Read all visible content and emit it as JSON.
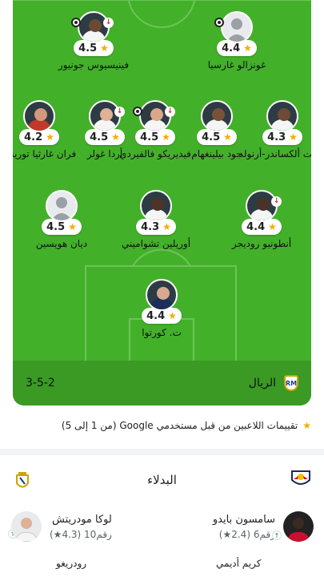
{
  "pitch": {
    "colors": {
      "grass": "#43b02a",
      "bar": "#3a9a24",
      "line": "#6cc456"
    },
    "team": {
      "name": "الريال",
      "formation": "3-5-2",
      "crest_text": "RM"
    },
    "players": [
      {
        "id": "vinicius",
        "name": "فينيسيوس جونيور",
        "rating": "4.5",
        "sub": true,
        "ball": true,
        "skin": "#6b4a34",
        "shirt": "#f5f5f5"
      },
      {
        "id": "garcia",
        "name": "غونزالو غارسيا",
        "rating": "4.4",
        "sub": false,
        "ball": true,
        "placeholder": true
      },
      {
        "id": "arnold",
        "name": "ترينت ألكساندر-أرنولد",
        "rating": "4.3",
        "sub": false,
        "ball": false,
        "skin": "#6e4b36",
        "shirt": "#f5f5f5"
      },
      {
        "id": "bellingham",
        "name": "جود بيلينغهام",
        "rating": "4.5",
        "sub": false,
        "ball": false,
        "skin": "#7a5238",
        "shirt": "#f5f5f5"
      },
      {
        "id": "valverde",
        "name": "فيديريكو فالفيردي",
        "rating": "4.5",
        "sub": true,
        "ball": true,
        "skin": "#d9a88a",
        "shirt": "#f5f5f5"
      },
      {
        "id": "guler",
        "name": "أردا غولر",
        "rating": "4.5",
        "sub": true,
        "ball": false,
        "skin": "#e0b195",
        "shirt": "#f5f5f5"
      },
      {
        "id": "torres",
        "name": "فران غارثيا توريس",
        "rating": "4.2",
        "sub": false,
        "ball": false,
        "skin": "#d29a7c",
        "shirt": "#c0392b"
      },
      {
        "id": "rudiger",
        "name": "أنطونيو روديجر",
        "rating": "4.4",
        "sub": true,
        "ball": false,
        "skin": "#4a3326",
        "shirt": "#f5f5f5"
      },
      {
        "id": "tchouameni",
        "name": "أوريلين تشواميني",
        "rating": "4.3",
        "sub": false,
        "ball": false,
        "skin": "#4e3427",
        "shirt": "#f5f5f5"
      },
      {
        "id": "huijsen",
        "name": "ديان هويسين",
        "rating": "4.5",
        "sub": false,
        "ball": false,
        "placeholder": true
      },
      {
        "id": "courtois",
        "name": "ت. كورتوا",
        "rating": "4.4",
        "sub": false,
        "ball": false,
        "skin": "#d8a98e",
        "shirt": "#1c2c5b"
      }
    ]
  },
  "note": {
    "text": "تقييمات اللاعبين من قبل مستخدمي Google (من 1 إلى 5)"
  },
  "subs": {
    "title": "البدلاء",
    "left": {
      "name": "لوكا مودريتش",
      "meta": "رقم10 (4.3★)",
      "skin": "#e0b195",
      "shirt": "#f5f5f5"
    },
    "right": {
      "name": "سامسون بايدو",
      "meta": "رقم6 (2.4★)",
      "skin": "#3b2a22",
      "shirt": "#c8102e"
    },
    "peek_left": "رودريغو",
    "peek_right": "كريم أديمي"
  },
  "icons": {
    "star": "star-icon",
    "sub_out": "sub-out-arrow-icon",
    "ball": "soccer-ball-icon"
  }
}
